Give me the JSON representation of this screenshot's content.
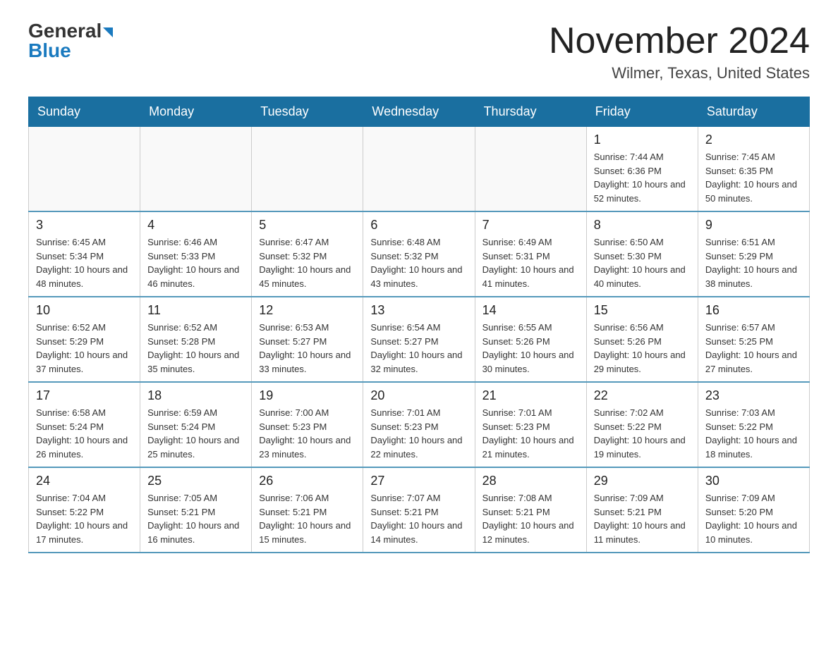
{
  "header": {
    "logo_general": "General",
    "logo_blue": "Blue",
    "month_title": "November 2024",
    "location": "Wilmer, Texas, United States"
  },
  "weekdays": [
    "Sunday",
    "Monday",
    "Tuesday",
    "Wednesday",
    "Thursday",
    "Friday",
    "Saturday"
  ],
  "weeks": [
    [
      {
        "day": "",
        "info": ""
      },
      {
        "day": "",
        "info": ""
      },
      {
        "day": "",
        "info": ""
      },
      {
        "day": "",
        "info": ""
      },
      {
        "day": "",
        "info": ""
      },
      {
        "day": "1",
        "info": "Sunrise: 7:44 AM\nSunset: 6:36 PM\nDaylight: 10 hours and 52 minutes."
      },
      {
        "day": "2",
        "info": "Sunrise: 7:45 AM\nSunset: 6:35 PM\nDaylight: 10 hours and 50 minutes."
      }
    ],
    [
      {
        "day": "3",
        "info": "Sunrise: 6:45 AM\nSunset: 5:34 PM\nDaylight: 10 hours and 48 minutes."
      },
      {
        "day": "4",
        "info": "Sunrise: 6:46 AM\nSunset: 5:33 PM\nDaylight: 10 hours and 46 minutes."
      },
      {
        "day": "5",
        "info": "Sunrise: 6:47 AM\nSunset: 5:32 PM\nDaylight: 10 hours and 45 minutes."
      },
      {
        "day": "6",
        "info": "Sunrise: 6:48 AM\nSunset: 5:32 PM\nDaylight: 10 hours and 43 minutes."
      },
      {
        "day": "7",
        "info": "Sunrise: 6:49 AM\nSunset: 5:31 PM\nDaylight: 10 hours and 41 minutes."
      },
      {
        "day": "8",
        "info": "Sunrise: 6:50 AM\nSunset: 5:30 PM\nDaylight: 10 hours and 40 minutes."
      },
      {
        "day": "9",
        "info": "Sunrise: 6:51 AM\nSunset: 5:29 PM\nDaylight: 10 hours and 38 minutes."
      }
    ],
    [
      {
        "day": "10",
        "info": "Sunrise: 6:52 AM\nSunset: 5:29 PM\nDaylight: 10 hours and 37 minutes."
      },
      {
        "day": "11",
        "info": "Sunrise: 6:52 AM\nSunset: 5:28 PM\nDaylight: 10 hours and 35 minutes."
      },
      {
        "day": "12",
        "info": "Sunrise: 6:53 AM\nSunset: 5:27 PM\nDaylight: 10 hours and 33 minutes."
      },
      {
        "day": "13",
        "info": "Sunrise: 6:54 AM\nSunset: 5:27 PM\nDaylight: 10 hours and 32 minutes."
      },
      {
        "day": "14",
        "info": "Sunrise: 6:55 AM\nSunset: 5:26 PM\nDaylight: 10 hours and 30 minutes."
      },
      {
        "day": "15",
        "info": "Sunrise: 6:56 AM\nSunset: 5:26 PM\nDaylight: 10 hours and 29 minutes."
      },
      {
        "day": "16",
        "info": "Sunrise: 6:57 AM\nSunset: 5:25 PM\nDaylight: 10 hours and 27 minutes."
      }
    ],
    [
      {
        "day": "17",
        "info": "Sunrise: 6:58 AM\nSunset: 5:24 PM\nDaylight: 10 hours and 26 minutes."
      },
      {
        "day": "18",
        "info": "Sunrise: 6:59 AM\nSunset: 5:24 PM\nDaylight: 10 hours and 25 minutes."
      },
      {
        "day": "19",
        "info": "Sunrise: 7:00 AM\nSunset: 5:23 PM\nDaylight: 10 hours and 23 minutes."
      },
      {
        "day": "20",
        "info": "Sunrise: 7:01 AM\nSunset: 5:23 PM\nDaylight: 10 hours and 22 minutes."
      },
      {
        "day": "21",
        "info": "Sunrise: 7:01 AM\nSunset: 5:23 PM\nDaylight: 10 hours and 21 minutes."
      },
      {
        "day": "22",
        "info": "Sunrise: 7:02 AM\nSunset: 5:22 PM\nDaylight: 10 hours and 19 minutes."
      },
      {
        "day": "23",
        "info": "Sunrise: 7:03 AM\nSunset: 5:22 PM\nDaylight: 10 hours and 18 minutes."
      }
    ],
    [
      {
        "day": "24",
        "info": "Sunrise: 7:04 AM\nSunset: 5:22 PM\nDaylight: 10 hours and 17 minutes."
      },
      {
        "day": "25",
        "info": "Sunrise: 7:05 AM\nSunset: 5:21 PM\nDaylight: 10 hours and 16 minutes."
      },
      {
        "day": "26",
        "info": "Sunrise: 7:06 AM\nSunset: 5:21 PM\nDaylight: 10 hours and 15 minutes."
      },
      {
        "day": "27",
        "info": "Sunrise: 7:07 AM\nSunset: 5:21 PM\nDaylight: 10 hours and 14 minutes."
      },
      {
        "day": "28",
        "info": "Sunrise: 7:08 AM\nSunset: 5:21 PM\nDaylight: 10 hours and 12 minutes."
      },
      {
        "day": "29",
        "info": "Sunrise: 7:09 AM\nSunset: 5:21 PM\nDaylight: 10 hours and 11 minutes."
      },
      {
        "day": "30",
        "info": "Sunrise: 7:09 AM\nSunset: 5:20 PM\nDaylight: 10 hours and 10 minutes."
      }
    ]
  ]
}
